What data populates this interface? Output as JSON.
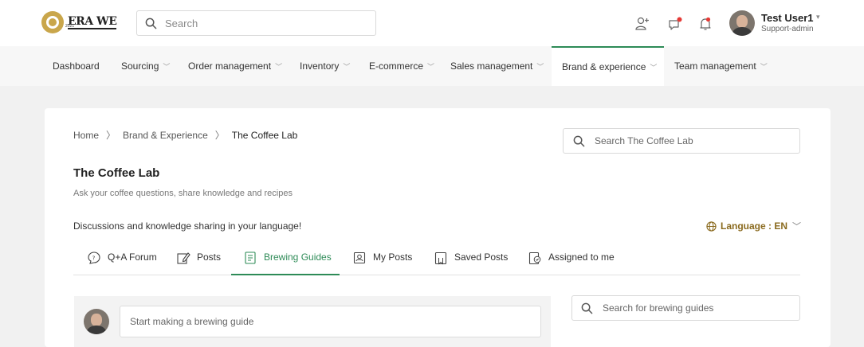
{
  "header": {
    "logo_text": "ERA WE",
    "logo_year": "2021",
    "search_placeholder": "Search",
    "icons": [
      "add-user-icon",
      "chat-icon",
      "bell-icon"
    ],
    "user": {
      "name": "Test User1",
      "role": "Support-admin"
    }
  },
  "nav": {
    "items": [
      {
        "label": "Dashboard",
        "dropdown": false
      },
      {
        "label": "Sourcing",
        "dropdown": true
      },
      {
        "label": "Order management",
        "dropdown": true
      },
      {
        "label": "Inventory",
        "dropdown": true
      },
      {
        "label": "E-commerce",
        "dropdown": true
      },
      {
        "label": "Sales management",
        "dropdown": true
      },
      {
        "label": "Brand & experience",
        "dropdown": true,
        "active": true
      },
      {
        "label": "Team management",
        "dropdown": true
      }
    ]
  },
  "breadcrumb": {
    "items": [
      "Home",
      "Brand & Experience",
      "The Coffee Lab"
    ]
  },
  "page": {
    "search_placeholder": "Search The Coffee Lab",
    "title": "The Coffee Lab",
    "subtitle": "Ask your coffee questions, share knowledge and recipes",
    "note": "Discussions and knowledge sharing in your language!",
    "language_label": "Language : EN"
  },
  "tabs": [
    {
      "label": "Q+A Forum",
      "icon": "forum-icon"
    },
    {
      "label": "Posts",
      "icon": "edit-post-icon"
    },
    {
      "label": "Brewing Guides",
      "icon": "guide-icon",
      "active": true
    },
    {
      "label": "My Posts",
      "icon": "my-posts-icon"
    },
    {
      "label": "Saved Posts",
      "icon": "bookmark-icon"
    },
    {
      "label": "Assigned to me",
      "icon": "assigned-icon"
    }
  ],
  "composer": {
    "placeholder": "Start making a brewing guide"
  },
  "guides_search": {
    "placeholder": "Search for brewing guides"
  },
  "colors": {
    "accent": "#2e8b57",
    "language": "#8a6a1e",
    "notification": "#e53935"
  }
}
